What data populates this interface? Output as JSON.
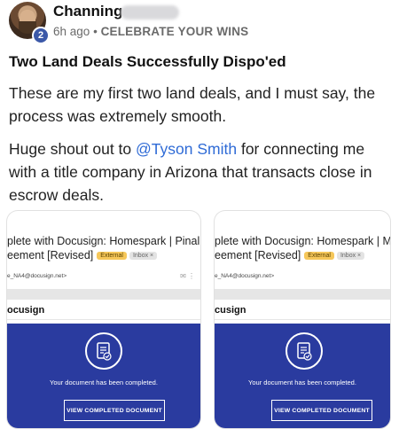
{
  "author": {
    "name": "Channing",
    "level": "2"
  },
  "meta": {
    "time": "6h ago",
    "separator": "•",
    "category": "CELEBRATE YOUR WINS"
  },
  "post": {
    "title": "Two Land Deals Successfully Dispo'ed",
    "paragraph1": "These are my first two land deals, and I must say, the process was extremely smooth.",
    "paragraph2_before": "Huge shout out to ",
    "mention": "@Tyson Smith",
    "paragraph2_after": " for connecting me with a title company in Arizona that transacts close in escrow deals."
  },
  "attachments": [
    {
      "subject_line1": "plete with Docusign: Homespark | Pinal County,",
      "subject_line2": "eement [Revised]",
      "tag_external": "External",
      "tag_inbox": "Inbox ×",
      "sender": "e_NA4@docusign.net>",
      "logo": "ocusign",
      "completed_text": "Your document has been completed.",
      "button_label": "VIEW COMPLETED DOCUMENT"
    },
    {
      "subject_line1": "plete with Docusign: Homespark | Mohave",
      "subject_line2": "eement [Revised]",
      "tag_external": "External",
      "tag_inbox": "Inbox ×",
      "sender": "e_NA4@docusign.net>",
      "logo": "cusign",
      "completed_text": "Your document has been completed.",
      "button_label": "VIEW COMPLETED DOCUMENT"
    }
  ],
  "colors": {
    "accent": "#2f6bd6",
    "docusign_blue": "#2a3b9f",
    "badge": "#3b58a8",
    "external_tag": "#f6c75a"
  },
  "icons": {
    "doc": "document-check-icon",
    "mini": "email-action-icons"
  }
}
